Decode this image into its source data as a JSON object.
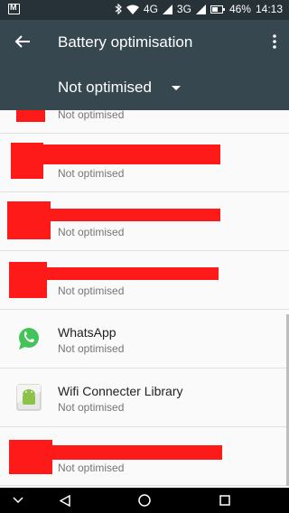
{
  "status_bar": {
    "network_label": "4G",
    "network2_label": "3G",
    "battery_percent": "46%",
    "time": "14:13"
  },
  "toolbar": {
    "title": "Battery optimisation"
  },
  "filter": {
    "selected": "Not optimised"
  },
  "apps": [
    {
      "name": "",
      "status": "Not optimised"
    },
    {
      "name": "",
      "status": "Not optimised"
    },
    {
      "name": "",
      "status": "Not optimised"
    },
    {
      "name": "",
      "status": "Not optimised"
    },
    {
      "name": "WhatsApp",
      "status": "Not optimised"
    },
    {
      "name": "Wifi Connecter Library",
      "status": "Not optimised"
    },
    {
      "name": "",
      "status": "Not optimised"
    }
  ],
  "colors": {
    "toolbar": "#37474f",
    "status_bar": "#263238",
    "redaction": "#ff1a1a"
  }
}
